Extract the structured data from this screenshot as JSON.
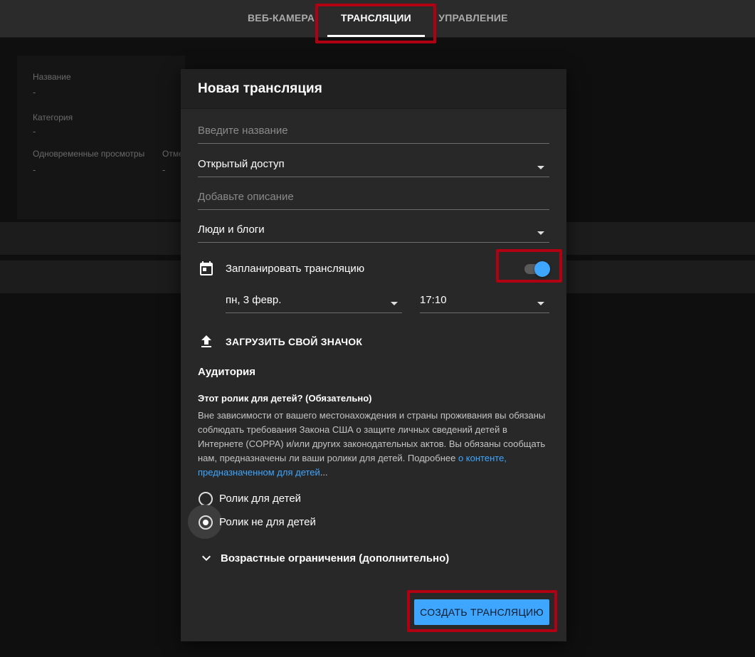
{
  "nav": {
    "tabs": [
      {
        "label": "ВЕБ-КАМЕРА"
      },
      {
        "label": "ТРАНСЛЯЦИИ"
      },
      {
        "label": "УПРАВЛЕНИЕ"
      }
    ],
    "active_tab": "ТРАНСЛЯЦИИ"
  },
  "background": {
    "fields": [
      {
        "label": "Название",
        "value": "-"
      },
      {
        "label": "Категория",
        "value": "-"
      },
      {
        "label": "Одновременные просмотры",
        "value": "-"
      },
      {
        "label": "Отме",
        "value": "-"
      }
    ]
  },
  "dialog": {
    "title": "Новая трансляция",
    "name_placeholder": "Введите название",
    "privacy_value": "Открытый доступ",
    "description_placeholder": "Добавьте описание",
    "category_value": "Люди и блоги",
    "schedule_label": "Запланировать трансляцию",
    "schedule_enabled": true,
    "schedule_date": "пн, 3 февр.",
    "schedule_time": "17:10",
    "upload_thumbnail_label": "ЗАГРУЗИТЬ СВОЙ ЗНАЧОК",
    "audience_heading": "Аудитория",
    "kids_question": "Этот ролик для детей? (Обязательно)",
    "coppa_text": "Вне зависимости от вашего местонахождения и страны проживания вы обязаны соблюдать требования Закона США о защите личных сведений детей в Интернете (COPPA) и/или других законодательных актов. Вы обязаны сообщать нам, предназначены ли ваши ролики для детей. Подробнее ",
    "coppa_link": "о контенте, предназначенном для детей",
    "coppa_ellipsis": "...",
    "radio_kids": "Ролик для детей",
    "radio_not_kids": "Ролик не для детей",
    "radio_selected": "Ролик не для детей",
    "age_restriction_label": "Возрастные ограничения (дополнительно)",
    "create_button": "СОЗДАТЬ ТРАНСЛЯЦИЮ"
  },
  "colors": {
    "accent": "#3ea6ff",
    "highlight_box": "#b00012",
    "dialog_bg": "#282828"
  }
}
